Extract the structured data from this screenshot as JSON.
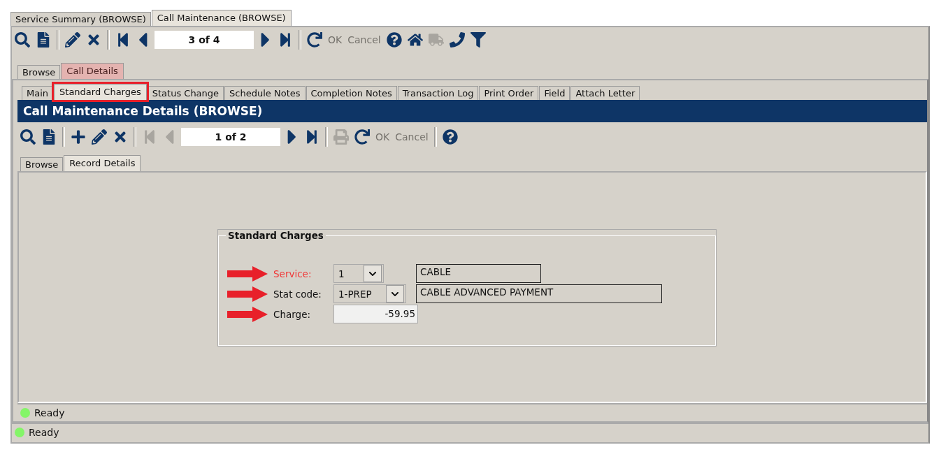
{
  "window_tabs": [
    {
      "label": "Service Summary (BROWSE)",
      "selected": false
    },
    {
      "label": "Call Maintenance (BROWSE)",
      "selected": true
    }
  ],
  "toolbar": [
    {
      "kind": "search",
      "disabled": false
    },
    {
      "kind": "preview",
      "disabled": false
    },
    {
      "kind": "separator"
    },
    {
      "kind": "edit",
      "disabled": false
    },
    {
      "kind": "delete",
      "disabled": false
    },
    {
      "kind": "separator"
    },
    {
      "kind": "first",
      "disabled": false
    },
    {
      "kind": "prev",
      "disabled": false
    },
    {
      "kind": "counter",
      "text": "3 of 4"
    },
    {
      "kind": "next",
      "disabled": false
    },
    {
      "kind": "last",
      "disabled": false
    },
    {
      "kind": "separator"
    },
    {
      "kind": "refresh",
      "disabled": false
    },
    {
      "kind": "text",
      "text": "OK",
      "disabled": true
    },
    {
      "kind": "text",
      "text": "Cancel",
      "disabled": true
    },
    {
      "kind": "help",
      "disabled": false
    },
    {
      "kind": "home",
      "disabled": false
    },
    {
      "kind": "truck",
      "disabled": true
    },
    {
      "kind": "phone",
      "disabled": false
    },
    {
      "kind": "filter",
      "disabled": false
    }
  ],
  "view_tabs": [
    {
      "label": "Browse",
      "selected": false
    },
    {
      "label": "Call Details",
      "selected": true
    }
  ],
  "detail_tabs": [
    {
      "label": "Main",
      "selected": false,
      "highlighted": false
    },
    {
      "label": "Standard Charges",
      "selected": true,
      "highlighted": true
    },
    {
      "label": "Status Change",
      "selected": false,
      "highlighted": false
    },
    {
      "label": "Schedule Notes",
      "selected": false,
      "highlighted": false
    },
    {
      "label": "Completion Notes",
      "selected": false,
      "highlighted": false
    },
    {
      "label": "Transaction Log",
      "selected": false,
      "highlighted": false
    },
    {
      "label": "Print Order",
      "selected": false,
      "highlighted": false
    },
    {
      "label": "Field",
      "selected": false,
      "highlighted": false
    },
    {
      "label": "Attach Letter",
      "selected": false,
      "highlighted": false
    }
  ],
  "section_title": "Call Maintenance Details (BROWSE)",
  "detail_toolbar": [
    {
      "kind": "search",
      "disabled": false
    },
    {
      "kind": "preview",
      "disabled": false
    },
    {
      "kind": "separator"
    },
    {
      "kind": "add",
      "disabled": false
    },
    {
      "kind": "edit",
      "disabled": false
    },
    {
      "kind": "delete",
      "disabled": false
    },
    {
      "kind": "separator"
    },
    {
      "kind": "first",
      "disabled": true
    },
    {
      "kind": "prev",
      "disabled": true
    },
    {
      "kind": "counter",
      "text": "1 of 2"
    },
    {
      "kind": "next",
      "disabled": false
    },
    {
      "kind": "last",
      "disabled": false
    },
    {
      "kind": "separator"
    },
    {
      "kind": "print",
      "disabled": true
    },
    {
      "kind": "refresh",
      "disabled": false
    },
    {
      "kind": "text",
      "text": "OK",
      "disabled": true
    },
    {
      "kind": "text",
      "text": "Cancel",
      "disabled": true
    },
    {
      "kind": "separator"
    },
    {
      "kind": "help",
      "disabled": false
    }
  ],
  "record_tabs": [
    {
      "label": "Browse",
      "selected": false
    },
    {
      "label": "Record Details",
      "selected": true
    }
  ],
  "group": {
    "title": "Standard Charges",
    "fields": [
      {
        "kind": "combo",
        "label": "Service:",
        "value": "1",
        "description": "CABLE",
        "required": true,
        "marked": true
      },
      {
        "kind": "combo",
        "label": "Stat code:",
        "value": "1-PREP",
        "description": "CABLE ADVANCED PAYMENT",
        "required": false,
        "marked": true
      },
      {
        "kind": "input",
        "label": "Charge:",
        "value": "-59.95",
        "required": false,
        "marked": true
      }
    ]
  },
  "inner_status": "Ready",
  "status_bar": "Ready"
}
